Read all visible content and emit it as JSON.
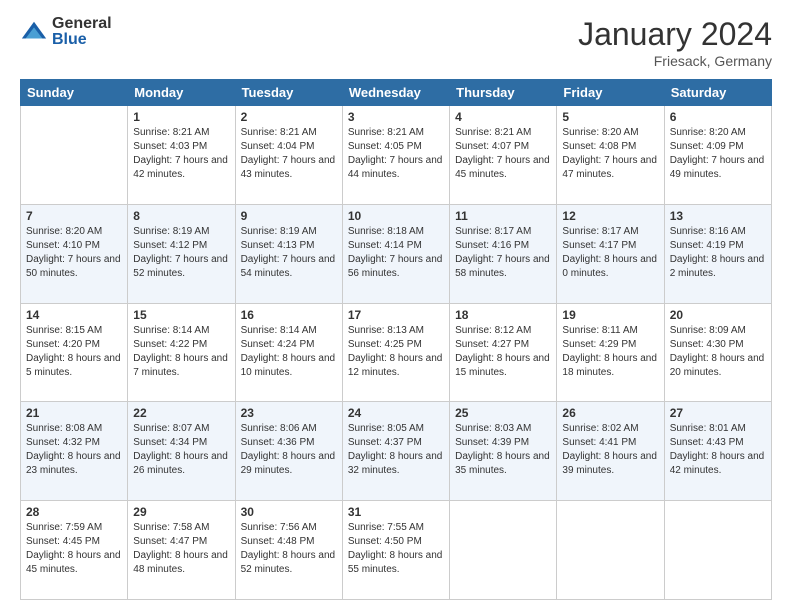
{
  "header": {
    "logo_general": "General",
    "logo_blue": "Blue",
    "month_year": "January 2024",
    "location": "Friesack, Germany"
  },
  "weekdays": [
    "Sunday",
    "Monday",
    "Tuesday",
    "Wednesday",
    "Thursday",
    "Friday",
    "Saturday"
  ],
  "weeks": [
    [
      {
        "day": "",
        "sunrise": "",
        "sunset": "",
        "daylight": ""
      },
      {
        "day": "1",
        "sunrise": "Sunrise: 8:21 AM",
        "sunset": "Sunset: 4:03 PM",
        "daylight": "Daylight: 7 hours and 42 minutes."
      },
      {
        "day": "2",
        "sunrise": "Sunrise: 8:21 AM",
        "sunset": "Sunset: 4:04 PM",
        "daylight": "Daylight: 7 hours and 43 minutes."
      },
      {
        "day": "3",
        "sunrise": "Sunrise: 8:21 AM",
        "sunset": "Sunset: 4:05 PM",
        "daylight": "Daylight: 7 hours and 44 minutes."
      },
      {
        "day": "4",
        "sunrise": "Sunrise: 8:21 AM",
        "sunset": "Sunset: 4:07 PM",
        "daylight": "Daylight: 7 hours and 45 minutes."
      },
      {
        "day": "5",
        "sunrise": "Sunrise: 8:20 AM",
        "sunset": "Sunset: 4:08 PM",
        "daylight": "Daylight: 7 hours and 47 minutes."
      },
      {
        "day": "6",
        "sunrise": "Sunrise: 8:20 AM",
        "sunset": "Sunset: 4:09 PM",
        "daylight": "Daylight: 7 hours and 49 minutes."
      }
    ],
    [
      {
        "day": "7",
        "sunrise": "Sunrise: 8:20 AM",
        "sunset": "Sunset: 4:10 PM",
        "daylight": "Daylight: 7 hours and 50 minutes."
      },
      {
        "day": "8",
        "sunrise": "Sunrise: 8:19 AM",
        "sunset": "Sunset: 4:12 PM",
        "daylight": "Daylight: 7 hours and 52 minutes."
      },
      {
        "day": "9",
        "sunrise": "Sunrise: 8:19 AM",
        "sunset": "Sunset: 4:13 PM",
        "daylight": "Daylight: 7 hours and 54 minutes."
      },
      {
        "day": "10",
        "sunrise": "Sunrise: 8:18 AM",
        "sunset": "Sunset: 4:14 PM",
        "daylight": "Daylight: 7 hours and 56 minutes."
      },
      {
        "day": "11",
        "sunrise": "Sunrise: 8:17 AM",
        "sunset": "Sunset: 4:16 PM",
        "daylight": "Daylight: 7 hours and 58 minutes."
      },
      {
        "day": "12",
        "sunrise": "Sunrise: 8:17 AM",
        "sunset": "Sunset: 4:17 PM",
        "daylight": "Daylight: 8 hours and 0 minutes."
      },
      {
        "day": "13",
        "sunrise": "Sunrise: 8:16 AM",
        "sunset": "Sunset: 4:19 PM",
        "daylight": "Daylight: 8 hours and 2 minutes."
      }
    ],
    [
      {
        "day": "14",
        "sunrise": "Sunrise: 8:15 AM",
        "sunset": "Sunset: 4:20 PM",
        "daylight": "Daylight: 8 hours and 5 minutes."
      },
      {
        "day": "15",
        "sunrise": "Sunrise: 8:14 AM",
        "sunset": "Sunset: 4:22 PM",
        "daylight": "Daylight: 8 hours and 7 minutes."
      },
      {
        "day": "16",
        "sunrise": "Sunrise: 8:14 AM",
        "sunset": "Sunset: 4:24 PM",
        "daylight": "Daylight: 8 hours and 10 minutes."
      },
      {
        "day": "17",
        "sunrise": "Sunrise: 8:13 AM",
        "sunset": "Sunset: 4:25 PM",
        "daylight": "Daylight: 8 hours and 12 minutes."
      },
      {
        "day": "18",
        "sunrise": "Sunrise: 8:12 AM",
        "sunset": "Sunset: 4:27 PM",
        "daylight": "Daylight: 8 hours and 15 minutes."
      },
      {
        "day": "19",
        "sunrise": "Sunrise: 8:11 AM",
        "sunset": "Sunset: 4:29 PM",
        "daylight": "Daylight: 8 hours and 18 minutes."
      },
      {
        "day": "20",
        "sunrise": "Sunrise: 8:09 AM",
        "sunset": "Sunset: 4:30 PM",
        "daylight": "Daylight: 8 hours and 20 minutes."
      }
    ],
    [
      {
        "day": "21",
        "sunrise": "Sunrise: 8:08 AM",
        "sunset": "Sunset: 4:32 PM",
        "daylight": "Daylight: 8 hours and 23 minutes."
      },
      {
        "day": "22",
        "sunrise": "Sunrise: 8:07 AM",
        "sunset": "Sunset: 4:34 PM",
        "daylight": "Daylight: 8 hours and 26 minutes."
      },
      {
        "day": "23",
        "sunrise": "Sunrise: 8:06 AM",
        "sunset": "Sunset: 4:36 PM",
        "daylight": "Daylight: 8 hours and 29 minutes."
      },
      {
        "day": "24",
        "sunrise": "Sunrise: 8:05 AM",
        "sunset": "Sunset: 4:37 PM",
        "daylight": "Daylight: 8 hours and 32 minutes."
      },
      {
        "day": "25",
        "sunrise": "Sunrise: 8:03 AM",
        "sunset": "Sunset: 4:39 PM",
        "daylight": "Daylight: 8 hours and 35 minutes."
      },
      {
        "day": "26",
        "sunrise": "Sunrise: 8:02 AM",
        "sunset": "Sunset: 4:41 PM",
        "daylight": "Daylight: 8 hours and 39 minutes."
      },
      {
        "day": "27",
        "sunrise": "Sunrise: 8:01 AM",
        "sunset": "Sunset: 4:43 PM",
        "daylight": "Daylight: 8 hours and 42 minutes."
      }
    ],
    [
      {
        "day": "28",
        "sunrise": "Sunrise: 7:59 AM",
        "sunset": "Sunset: 4:45 PM",
        "daylight": "Daylight: 8 hours and 45 minutes."
      },
      {
        "day": "29",
        "sunrise": "Sunrise: 7:58 AM",
        "sunset": "Sunset: 4:47 PM",
        "daylight": "Daylight: 8 hours and 48 minutes."
      },
      {
        "day": "30",
        "sunrise": "Sunrise: 7:56 AM",
        "sunset": "Sunset: 4:48 PM",
        "daylight": "Daylight: 8 hours and 52 minutes."
      },
      {
        "day": "31",
        "sunrise": "Sunrise: 7:55 AM",
        "sunset": "Sunset: 4:50 PM",
        "daylight": "Daylight: 8 hours and 55 minutes."
      },
      {
        "day": "",
        "sunrise": "",
        "sunset": "",
        "daylight": ""
      },
      {
        "day": "",
        "sunrise": "",
        "sunset": "",
        "daylight": ""
      },
      {
        "day": "",
        "sunrise": "",
        "sunset": "",
        "daylight": ""
      }
    ]
  ]
}
